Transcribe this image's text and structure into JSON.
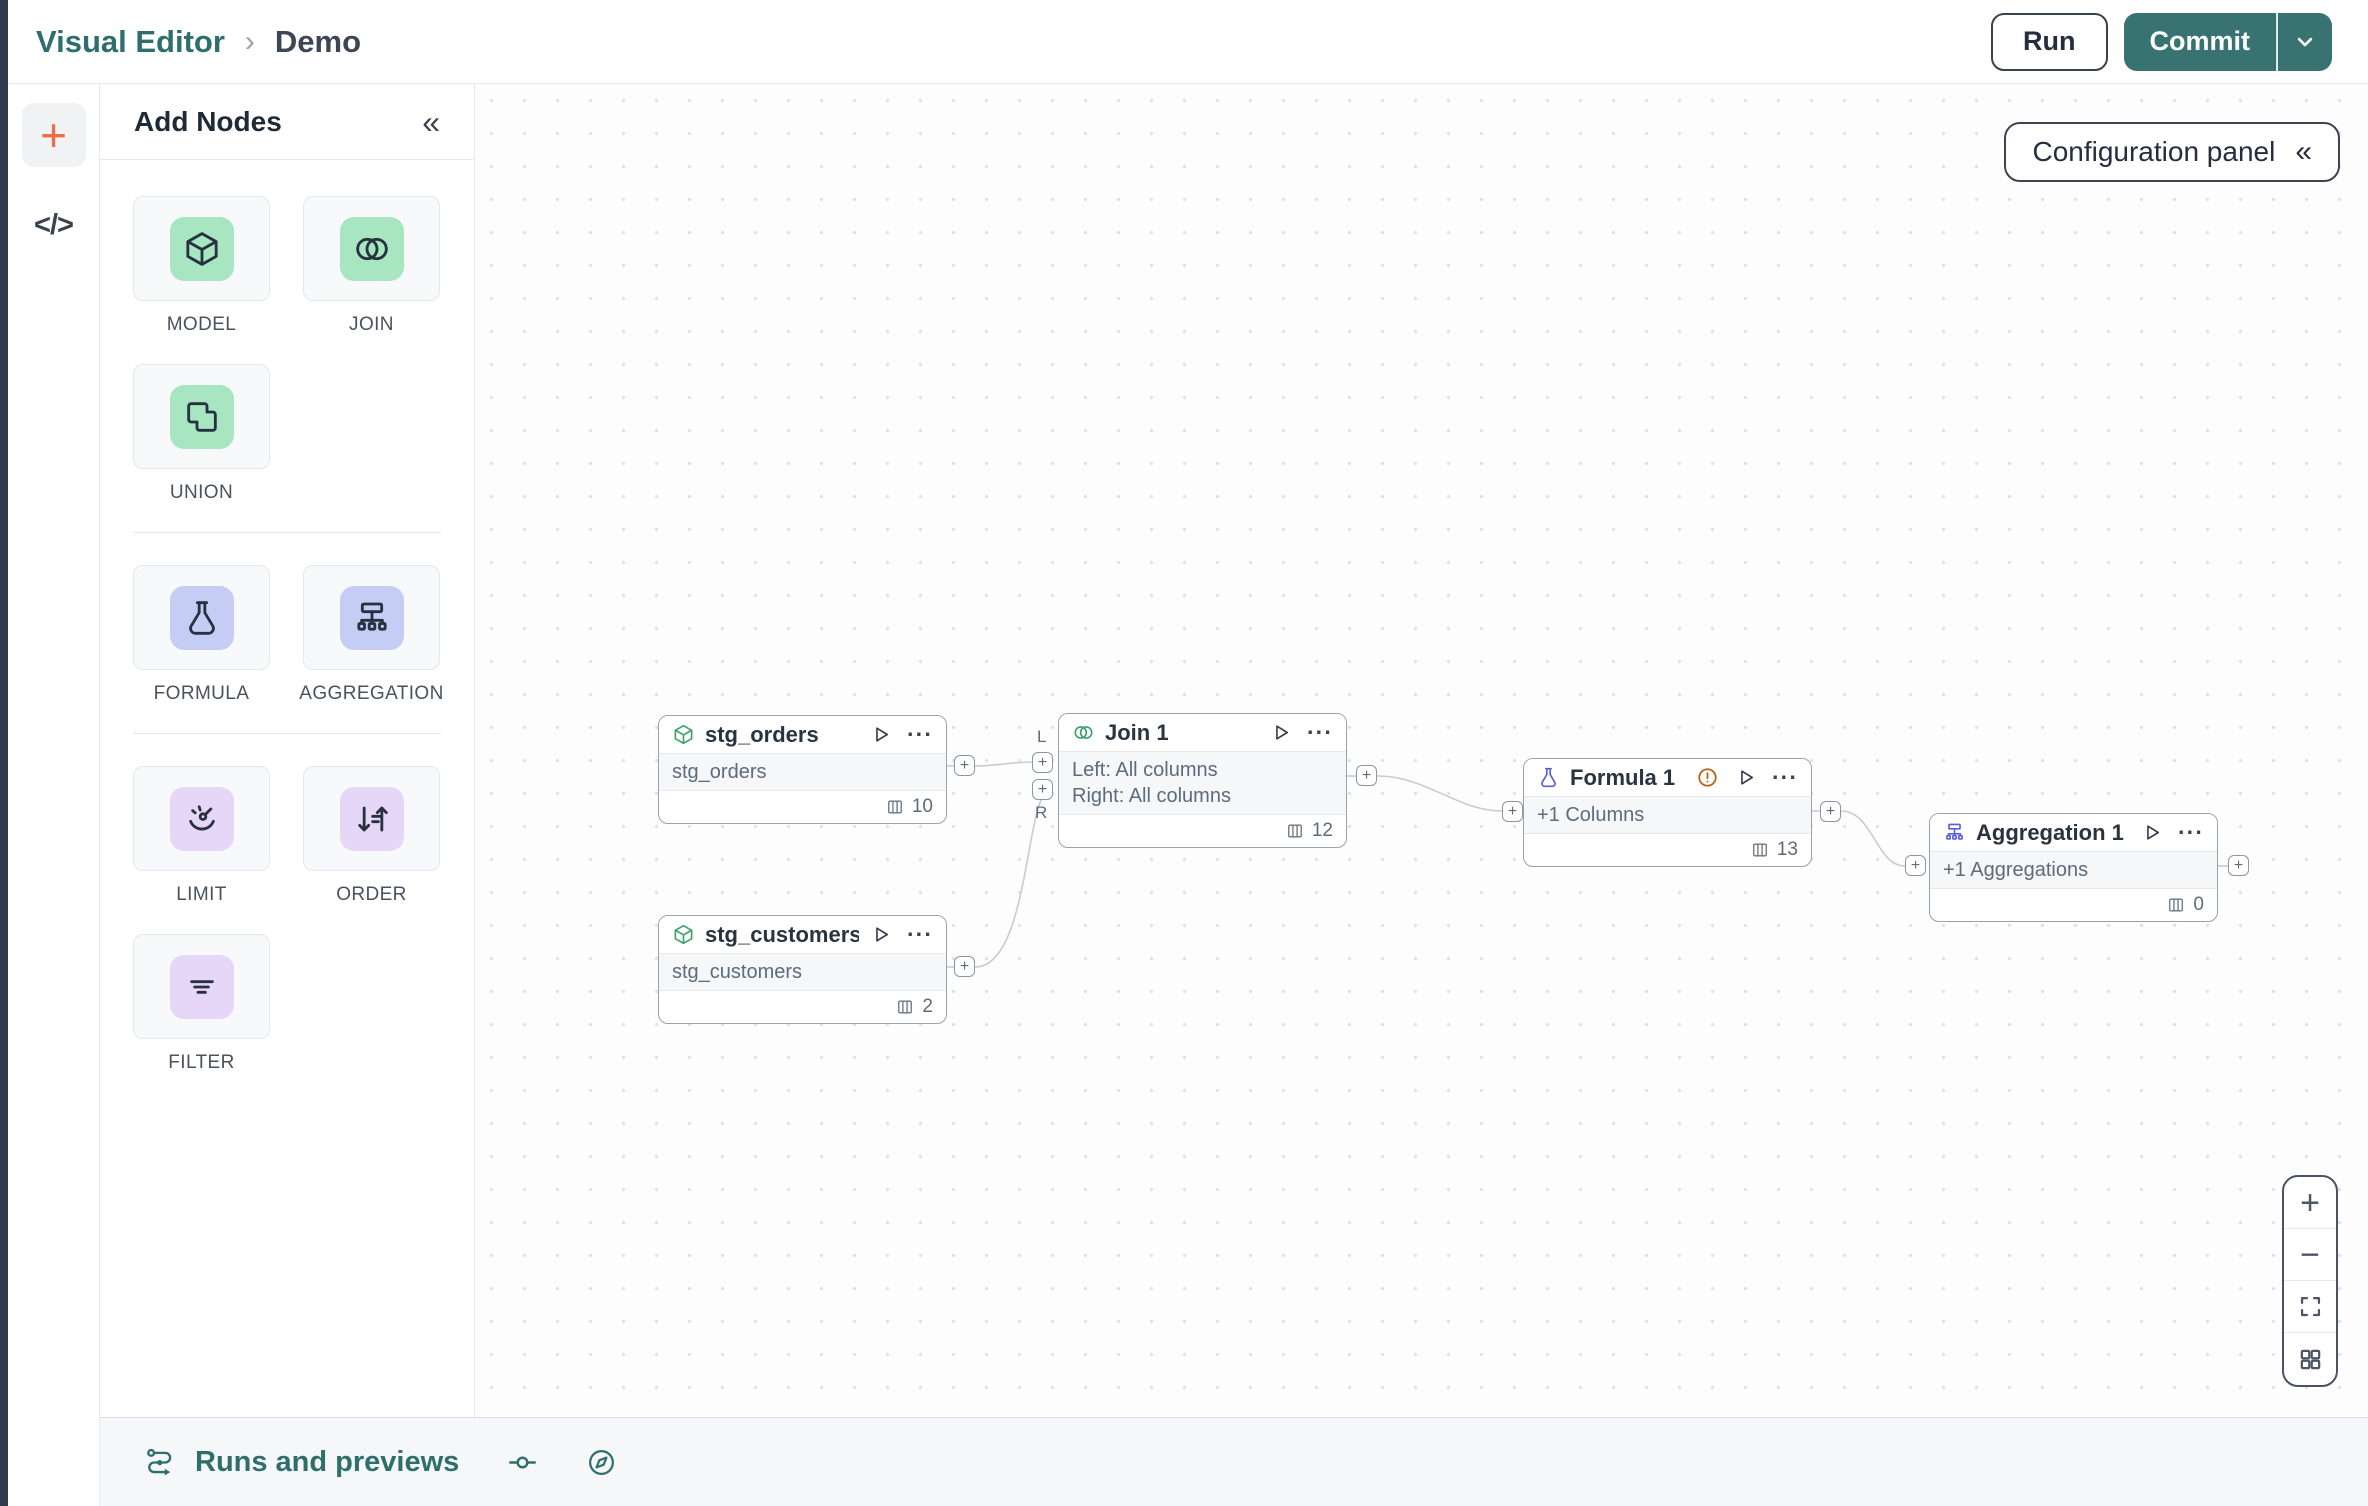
{
  "glyphs": {
    "plus": "+",
    "minus": "−",
    "collapse": "«",
    "breadcrumb_separator": "›",
    "code": "</>",
    "dots_menu": "···"
  },
  "colors": {
    "brand_teal": "#2e6e6c",
    "commit_teal": "#387371",
    "accent_orange": "#ed6c49",
    "node_green": "#3da067",
    "node_indigo": "#5a5ed9",
    "warning_orange": "#b5641c",
    "tile_green": "#a8e6c2",
    "tile_periwinkle": "#c6cdf4",
    "tile_purple": "#e6d6f8"
  },
  "header": {
    "breadcrumb": {
      "root": "Visual Editor",
      "current": "Demo"
    },
    "run_button": "Run",
    "commit_button": "Commit"
  },
  "add_nodes_panel": {
    "title": "Add Nodes",
    "tiles": {
      "model": "MODEL",
      "join": "JOIN",
      "union": "UNION",
      "formula": "FORMULA",
      "aggregation": "AGGREGATION",
      "limit": "LIMIT",
      "order": "ORDER",
      "filter": "FILTER"
    }
  },
  "canvas": {
    "configuration_panel": "Configuration panel",
    "join_port_labels": {
      "left": "L",
      "right": "R"
    },
    "nodes": [
      {
        "title": "stg_orders",
        "type": "model",
        "body_lines": [
          "stg_orders"
        ],
        "column_count": "10"
      },
      {
        "title": "stg_customers",
        "type": "model",
        "body_lines": [
          "stg_customers"
        ],
        "column_count": "2"
      },
      {
        "title": "Join 1",
        "type": "join",
        "body_lines": [
          "Left: All columns",
          "Right: All columns"
        ],
        "column_count": "12"
      },
      {
        "title": "Formula 1",
        "type": "formula",
        "has_warning": true,
        "body_lines": [
          "+1 Columns"
        ],
        "column_count": "13"
      },
      {
        "title": "Aggregation 1",
        "type": "aggregation",
        "body_lines": [
          "+1 Aggregations"
        ],
        "column_count": "0"
      }
    ]
  },
  "bottom_bar": {
    "runs_label": "Runs and previews"
  }
}
